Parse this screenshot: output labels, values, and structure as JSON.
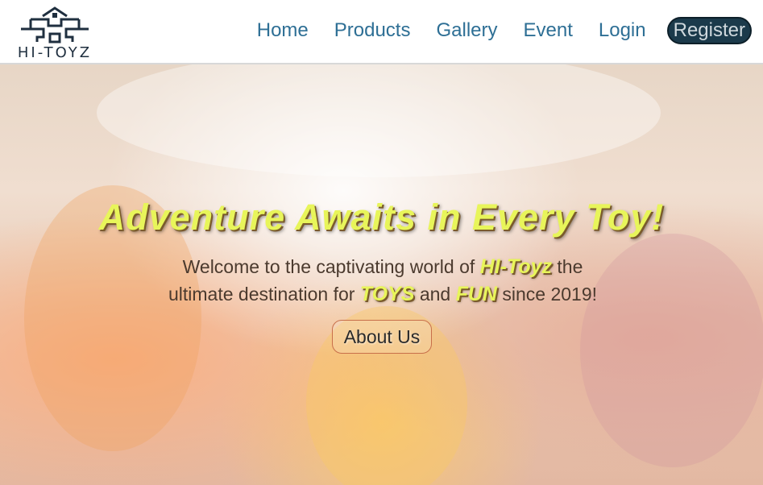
{
  "brand": {
    "name": "HI-TOYZ"
  },
  "nav": {
    "home": "Home",
    "products": "Products",
    "gallery": "Gallery",
    "event": "Event",
    "login": "Login",
    "register": "Register"
  },
  "hero": {
    "headline": "Adventure Awaits in Every Toy!",
    "line1_prefix": "Welcome to the captivating world of",
    "brand_highlight": "HI-Toyz",
    "line1_suffix": "the",
    "line2_prefix": "ultimate destination for",
    "toys_highlight": "TOYS",
    "and_word": "and",
    "fun_highlight": "FUN",
    "line2_suffix": "since 2019!",
    "cta": "About Us"
  },
  "colors": {
    "nav_link": "#2e6f95",
    "register_bg": "#1b3a4b",
    "highlight": "#e8f55a"
  },
  "icons": {
    "logo": "house-logo-icon"
  }
}
